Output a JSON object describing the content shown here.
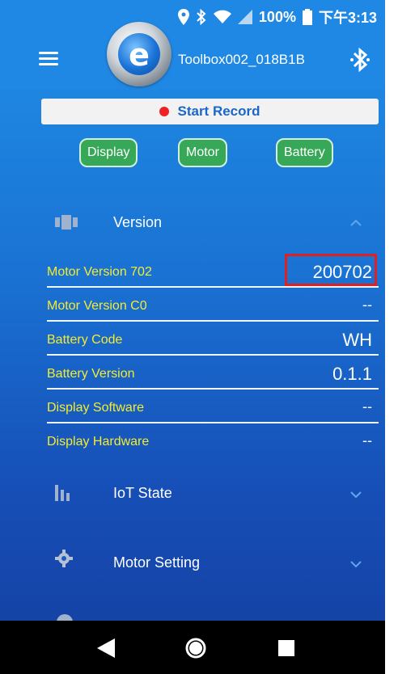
{
  "status_bar": {
    "battery_percent": "100%",
    "time": "下午3:13"
  },
  "app_bar": {
    "title": "Toolbox002_018B1B",
    "logo_letter": "e"
  },
  "record": {
    "label": "Start Record"
  },
  "chips": [
    "Display",
    "Motor",
    "Battery"
  ],
  "version_section": {
    "title": "Version",
    "rows": [
      {
        "label": "Motor Version 702",
        "value": "200702"
      },
      {
        "label": "Motor Version C0",
        "value": "--"
      },
      {
        "label": "Battery Code",
        "value": "WH"
      },
      {
        "label": "Battery Version",
        "value": "0.1.1"
      },
      {
        "label": "Display Software",
        "value": "--"
      },
      {
        "label": "Display Hardware",
        "value": "--"
      }
    ]
  },
  "sections": {
    "iot": "IoT State",
    "motor": "Motor Setting"
  },
  "colors": {
    "header_blue": "#1f88e4",
    "label_yellow": "#f4ec2f",
    "chip_green": "#37a857",
    "record_red": "#ee2222",
    "highlight_red": "#e01f1f"
  }
}
